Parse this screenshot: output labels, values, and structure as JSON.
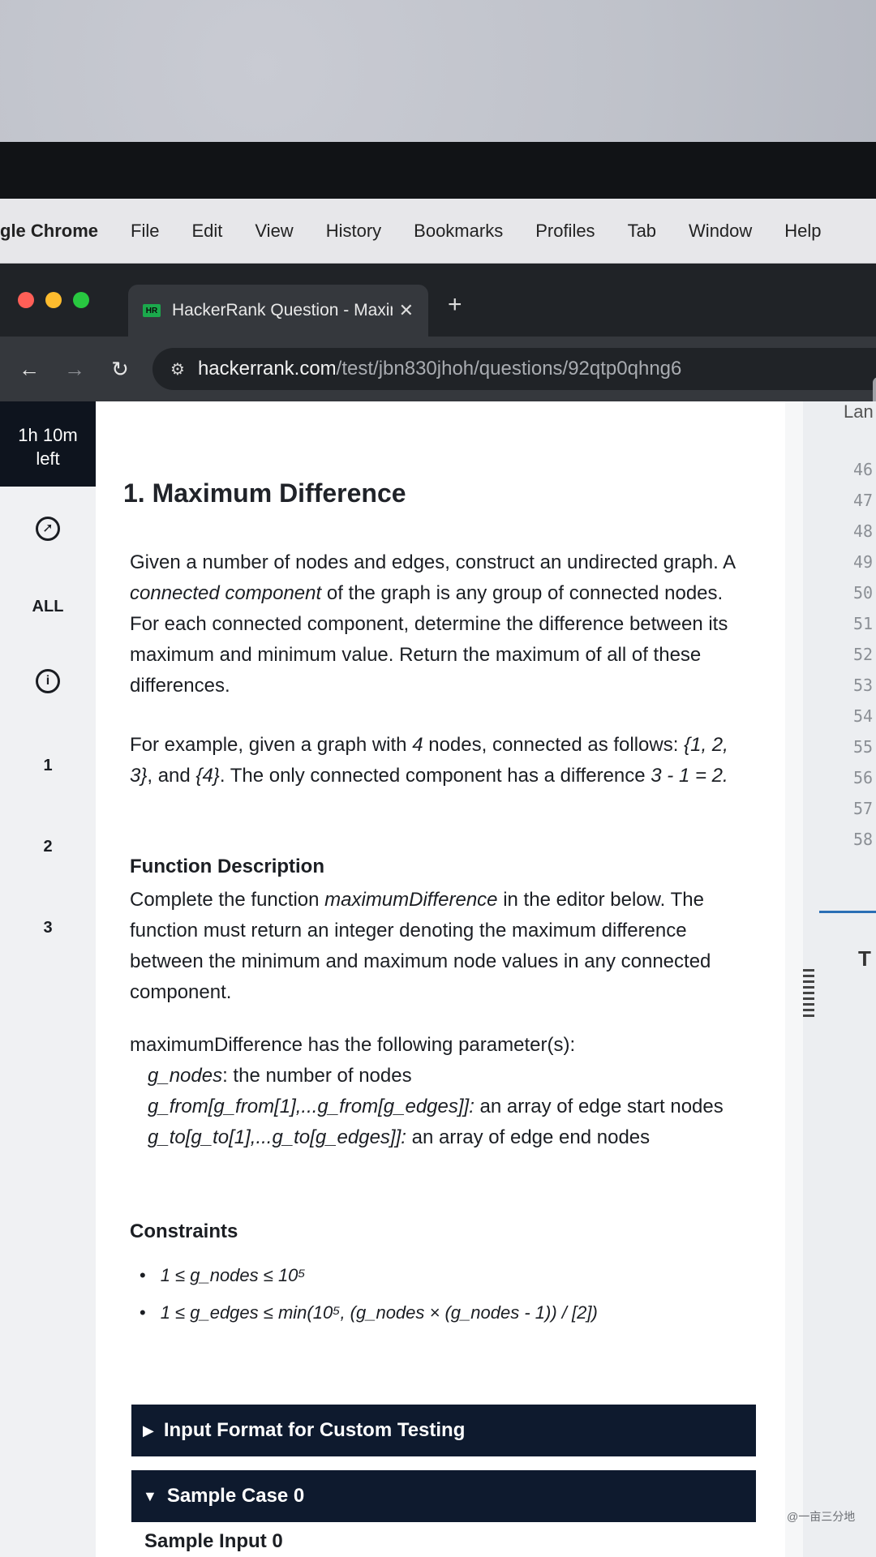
{
  "menubar": {
    "app": "gle Chrome",
    "items": [
      "File",
      "Edit",
      "View",
      "History",
      "Bookmarks",
      "Profiles",
      "Tab",
      "Window",
      "Help"
    ]
  },
  "tab": {
    "favicon": "HR",
    "title": "HackerRank Question - Maxin",
    "close": "✕",
    "new_tab": "+"
  },
  "address": {
    "host": "hackerrank.com",
    "path": "/test/jbn830jhoh/questions/92qtp0qhng6"
  },
  "nav": {
    "back": "←",
    "forward": "→",
    "reload": "↻",
    "site_info": "⚙"
  },
  "sidebar": {
    "timer_line1": "1h 10m",
    "timer_line2": "left",
    "all_label": "ALL",
    "questions": [
      "1",
      "2",
      "3"
    ],
    "icons": [
      "compass-icon",
      "info-icon"
    ]
  },
  "question": {
    "title": "1. Maximum Difference",
    "intro_1": "Given a number of nodes and edges, construct an undirected graph. A ",
    "intro_em": "connected component",
    "intro_2": " of the graph is any group of connected nodes. For each connected component, determine the difference between its maximum and minimum value. Return the maximum of all of these differences.",
    "example_1": "For example, given a graph with ",
    "example_n": "4",
    "example_2": " nodes, connected as follows: ",
    "example_set1": "{1, 2, 3}",
    "example_3": ", and ",
    "example_set2": "{4}",
    "example_4": ". The only connected component has a difference ",
    "example_calc": "3 - 1 = 2.",
    "func_heading": "Function Description",
    "func_1": "Complete the function ",
    "func_name": "maximumDifference",
    "func_2": " in the editor below. The function must return an integer denoting the maximum difference between the minimum and maximum node values in any connected component.",
    "params_intro": "maximumDifference has the following parameter(s):",
    "param1_name": "g_nodes",
    "param1_desc": ": the number of nodes",
    "param2_name": "g_from[g_from[1],...g_from[g_edges]]:",
    "param2_desc": " an array of edge start nodes",
    "param3_name": "g_to[g_to[1],...g_to[g_edges]]:",
    "param3_desc": " an array of edge end nodes",
    "constraints_heading": "Constraints",
    "constraint1": "1 ≤ g_nodes ≤ 10⁵",
    "constraint2": "1 ≤ g_edges ≤ min(10⁵, (g_nodes × (g_nodes - 1)) / [2])",
    "bar1": "Input Format for Custom Testing",
    "bar1_arrow": "▶",
    "bar2": "Sample Case 0",
    "bar2_arrow": "▼",
    "sample_input": "Sample Input 0"
  },
  "editor": {
    "language_label": "Lan",
    "line_numbers": [
      "46",
      "47",
      "48",
      "49",
      "50",
      "51",
      "52",
      "53",
      "54",
      "55",
      "56",
      "57",
      "58"
    ],
    "tab_letter": "T"
  },
  "watermark": "@一亩三分地",
  "colors": {
    "hr_green": "#1ba94c",
    "navy": "#0e1a2e",
    "timer_bg": "#0e141e"
  }
}
